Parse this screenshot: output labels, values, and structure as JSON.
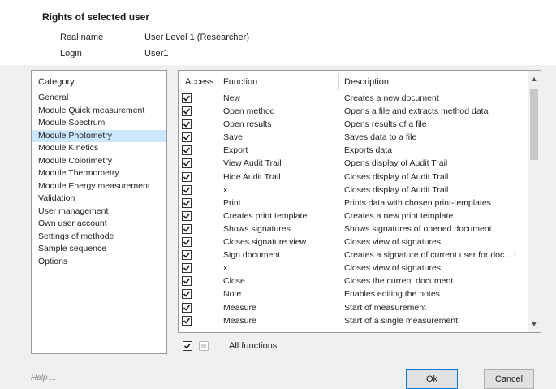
{
  "rights": {
    "title": "Rights of selected user",
    "real_name_label": "Real name",
    "real_name_value": "User Level 1 (Researcher)",
    "login_label": "Login",
    "login_value": "User1"
  },
  "categories": {
    "header": "Category",
    "selected": "Module Photometry",
    "items": [
      "General",
      "Module Quick measurement",
      "Module Spectrum",
      "Module Photometry",
      "Module Kinetics",
      "Module Colorimetry",
      "Module Thermometry",
      "Module Energy measurement",
      "Validation",
      "User management",
      "Own user account",
      "Settings of methode",
      "Sample sequence",
      "Options"
    ]
  },
  "functions_table": {
    "columns": {
      "access": "Access",
      "function": "Function",
      "description": "Description"
    },
    "rows": [
      {
        "access": true,
        "function": "New",
        "description": "Creates a new document"
      },
      {
        "access": true,
        "function": "Open method",
        "description": "Opens a file and extracts method data"
      },
      {
        "access": true,
        "function": "Open results",
        "description": "Opens results of a file"
      },
      {
        "access": true,
        "function": "Save",
        "description": "Saves data to a file"
      },
      {
        "access": true,
        "function": "Export",
        "description": "Exports data"
      },
      {
        "access": true,
        "function": "View Audit Trail",
        "description": "Opens display of Audit Trail"
      },
      {
        "access": true,
        "function": "Hide Audit Trail",
        "description": "Closes display of Audit Trail"
      },
      {
        "access": true,
        "function": "x",
        "description": "Closes display of Audit Trail"
      },
      {
        "access": true,
        "function": "Print",
        "description": "Prints data with chosen print-templates"
      },
      {
        "access": true,
        "function": "Creates print template",
        "description": "Creates a new print template"
      },
      {
        "access": true,
        "function": "Shows signatures",
        "description": "Shows signatures of opened document"
      },
      {
        "access": true,
        "function": "Closes signature view",
        "description": "Closes view of signatures"
      },
      {
        "access": true,
        "function": "Sign document",
        "description": "Creates a signature of current user for doc... ı"
      },
      {
        "access": true,
        "function": "x",
        "description": "Closes view of signatures"
      },
      {
        "access": true,
        "function": "Close",
        "description": "Closes the current document"
      },
      {
        "access": true,
        "function": "Note",
        "description": "Enables editing the notes"
      },
      {
        "access": true,
        "function": "Measure",
        "description": "Start of measurement"
      },
      {
        "access": true,
        "function": "Measure",
        "description": "Start of a single measurement"
      }
    ],
    "scroll_up_icon": "chevron-up-icon",
    "scroll_down_icon": "chevron-down-icon"
  },
  "all_functions": {
    "label": "All functions",
    "checked": true
  },
  "footer": {
    "help": "Help ...",
    "ok_label": "Ok",
    "cancel_label": "Cancel"
  },
  "colors": {
    "selection": "#cce8ff",
    "background": "#f0f0f0",
    "panel": "#ffffff",
    "ok_border": "#0078d7"
  }
}
